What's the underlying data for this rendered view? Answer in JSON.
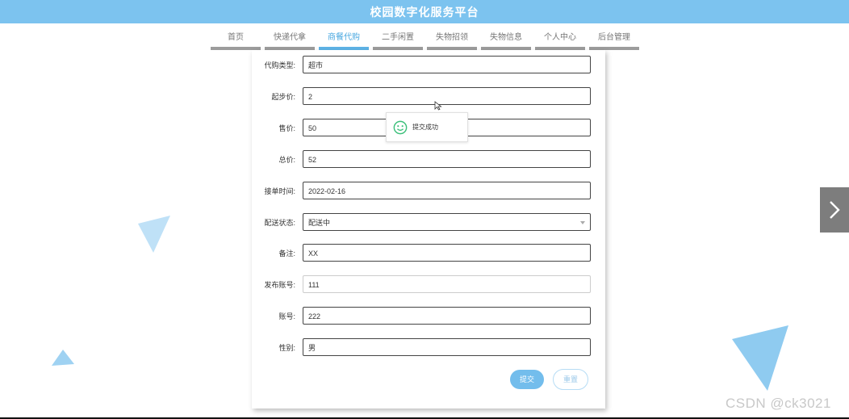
{
  "header": {
    "title": "校园数字化服务平台"
  },
  "nav": {
    "items": [
      {
        "label": "首页",
        "active": false
      },
      {
        "label": "快递代拿",
        "active": false
      },
      {
        "label": "商餐代购",
        "active": true
      },
      {
        "label": "二手闲置",
        "active": false
      },
      {
        "label": "失物招领",
        "active": false
      },
      {
        "label": "失物信息",
        "active": false
      },
      {
        "label": "个人中心",
        "active": false
      },
      {
        "label": "后台管理",
        "active": false
      }
    ]
  },
  "form": {
    "fields": [
      {
        "label": "代购类型:",
        "value": "超市"
      },
      {
        "label": "起步价:",
        "value": "2"
      },
      {
        "label": "售价:",
        "value": "50"
      },
      {
        "label": "总价:",
        "value": "52"
      },
      {
        "label": "接单时间:",
        "value": "2022-02-16"
      },
      {
        "label": "配送状态:",
        "value": "配送中"
      },
      {
        "label": "备注:",
        "value": "XX"
      },
      {
        "label": "发布账号:",
        "value": "111"
      },
      {
        "label": "账号:",
        "value": "222"
      },
      {
        "label": "性别:",
        "value": "男"
      }
    ],
    "submit_label": "提交",
    "reset_label": "重置"
  },
  "toast": {
    "text": "提交成功"
  },
  "watermark": "CSDN @ck3021",
  "colors": {
    "header": "#7cc3ef",
    "accent": "#5eb3e6",
    "success": "#3bbf7a",
    "side_arrow": "#7d7d7d",
    "triangle": "#8fcbf0"
  },
  "icons": {
    "toast": "smile-icon",
    "side": "chevron-right-icon",
    "select": "caret-down-icon",
    "cursor": "mouse-cursor-icon"
  }
}
